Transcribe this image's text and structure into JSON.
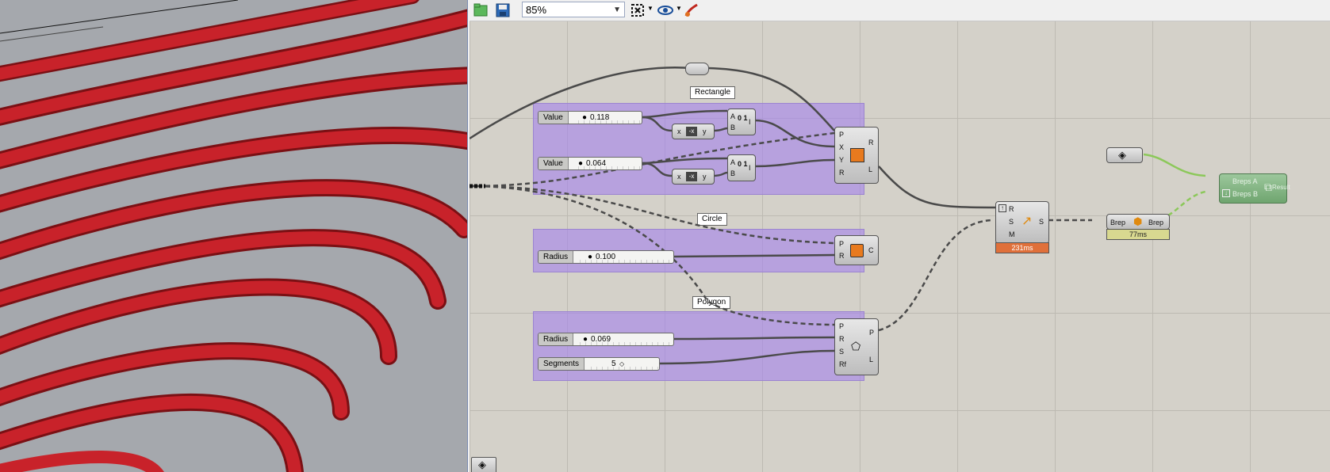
{
  "toolbar": {
    "zoom_value": "85%"
  },
  "groups": {
    "rectangle_label": "Rectangle",
    "circle_label": "Circle",
    "polygon_label": "Polygon"
  },
  "sliders": [
    {
      "name": "Value",
      "value": "0.118"
    },
    {
      "name": "Value",
      "value": "0.064"
    },
    {
      "name": "Radius",
      "value": "0.100"
    },
    {
      "name": "Radius",
      "value": "0.069"
    },
    {
      "name": "Segments",
      "value": "5"
    }
  ],
  "components": {
    "gate_inputs": [
      "A",
      "B"
    ],
    "gate_output": "I",
    "expr_x": "x",
    "expr_y": "y",
    "rectangle_inputs": [
      "P",
      "X",
      "Y",
      "R"
    ],
    "rectangle_outputs": [
      "R",
      "L"
    ],
    "circle_inputs": [
      "P",
      "R"
    ],
    "circle_output": "C",
    "polygon_inputs": [
      "P",
      "R",
      "S",
      "Rf"
    ],
    "polygon_outputs": [
      "P",
      "L"
    ],
    "sweep_inputs": [
      "R",
      "S",
      "M"
    ],
    "sweep_output": "S",
    "sweep_time": "231ms",
    "brep_input": "Brep",
    "brep_output": "Brep",
    "brep_time": "77ms",
    "boolean_inputs": [
      "Breps A",
      "Breps B"
    ],
    "boolean_output": "Result"
  },
  "colors": {
    "group_fill": "#a582eb",
    "sweep_timer": "#e0703a",
    "brep_timer": "#d8d890",
    "boolean_fill": "#7fb07f",
    "tube_red": "#c8222a"
  }
}
